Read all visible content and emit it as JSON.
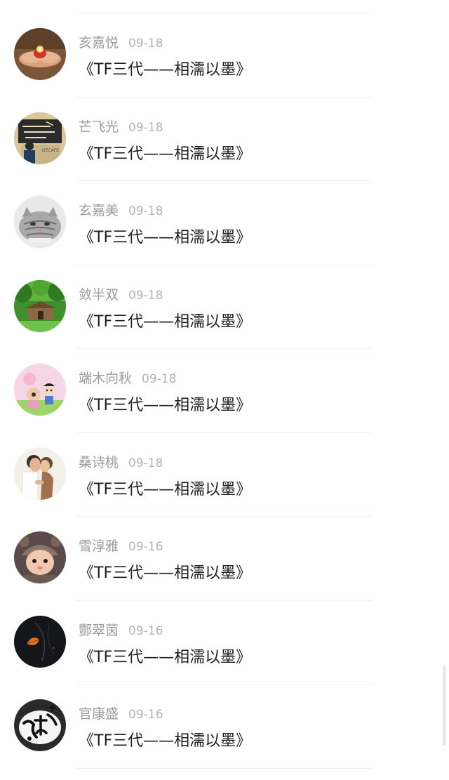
{
  "comments": [
    {
      "name": "亥嘉悦",
      "date": "09-18",
      "text": "《TF三代——相濡以墨》",
      "avatar_icon": "candle-hands"
    },
    {
      "name": "芒飞光",
      "date": "09-18",
      "text": "《TF三代——相濡以墨》",
      "avatar_icon": "chalkboard-person"
    },
    {
      "name": "玄嘉美",
      "date": "09-18",
      "text": "《TF三代——相濡以墨》",
      "avatar_icon": "grey-cat"
    },
    {
      "name": "敛半双",
      "date": "09-18",
      "text": "《TF三代——相濡以墨》",
      "avatar_icon": "forest-cabin"
    },
    {
      "name": "端木向秋",
      "date": "09-18",
      "text": "《TF三代——相濡以墨》",
      "avatar_icon": "cartoon-kids"
    },
    {
      "name": "桑诗桃",
      "date": "09-18",
      "text": "《TF三代——相濡以墨》",
      "avatar_icon": "couple-kiss"
    },
    {
      "name": "雪淳雅",
      "date": "09-16",
      "text": "《TF三代——相濡以墨》",
      "avatar_icon": "baby-bear-hat"
    },
    {
      "name": "酆翠茵",
      "date": "09-16",
      "text": "《TF三代——相濡以墨》",
      "avatar_icon": "dark-leaf"
    },
    {
      "name": "官康盛",
      "date": "09-16",
      "text": "《TF三代——相濡以墨》",
      "avatar_icon": "calligraphy-ink"
    }
  ],
  "colors": {
    "name": "#9b9b9b",
    "date": "#b3b3b3",
    "text": "#1e1e1e",
    "divider": "#f0f0f0"
  }
}
